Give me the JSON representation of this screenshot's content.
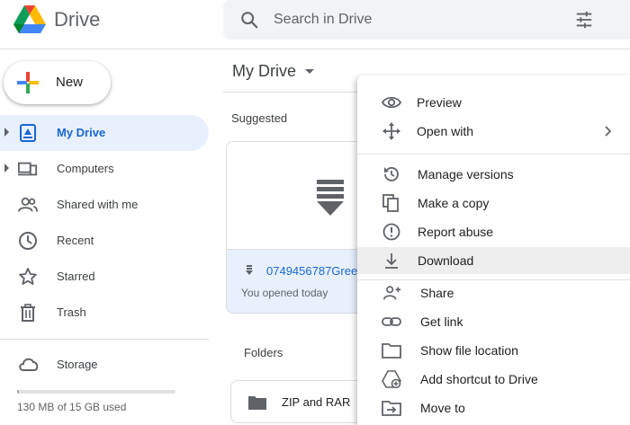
{
  "app": {
    "name": "Drive"
  },
  "search": {
    "placeholder": "Search in Drive"
  },
  "sidebar": {
    "new_label": "New",
    "items": [
      {
        "label": "My Drive",
        "active": true,
        "expandable": true,
        "icon": "my-drive-icon"
      },
      {
        "label": "Computers",
        "active": false,
        "expandable": true,
        "icon": "computers-icon"
      },
      {
        "label": "Shared with me",
        "active": false,
        "expandable": false,
        "icon": "people-icon"
      },
      {
        "label": "Recent",
        "active": false,
        "expandable": false,
        "icon": "clock-icon"
      },
      {
        "label": "Starred",
        "active": false,
        "expandable": false,
        "icon": "star-icon"
      },
      {
        "label": "Trash",
        "active": false,
        "expandable": false,
        "icon": "trash-icon"
      }
    ],
    "storage": {
      "label": "Storage",
      "usage_text": "130 MB of 15 GB used",
      "used_fraction": 0.0087
    }
  },
  "main": {
    "title": "My Drive",
    "suggested_label": "Suggested",
    "suggested_file": {
      "name": "0749456787Gree",
      "subtitle": "You opened today",
      "icon": "zip-file-icon"
    },
    "folders_label": "Folders",
    "folders": [
      {
        "name": "ZIP and RAR",
        "icon": "folder-icon"
      }
    ]
  },
  "context_menu": {
    "items": [
      {
        "label": "Preview",
        "icon": "eye-icon"
      },
      {
        "label": "Open with",
        "icon": "move-arrows-icon",
        "submenu": true
      },
      {
        "label": "Manage versions",
        "icon": "history-icon"
      },
      {
        "label": "Make a copy",
        "icon": "copy-icon"
      },
      {
        "label": "Report abuse",
        "icon": "alert-icon"
      },
      {
        "label": "Download",
        "icon": "download-icon",
        "highlighted": true
      },
      {
        "label": "Share",
        "icon": "add-person-icon"
      },
      {
        "label": "Get link",
        "icon": "link-icon"
      },
      {
        "label": "Show file location",
        "icon": "folder-outline-icon"
      },
      {
        "label": "Add shortcut to Drive",
        "icon": "shortcut-icon"
      },
      {
        "label": "Move to",
        "icon": "move-to-icon"
      }
    ]
  },
  "colors": {
    "accent_blue": "#1967d2",
    "active_nav_bg": "#e8f0fe",
    "search_bg": "#f1f3f4",
    "menu_highlight": "#eeeeee",
    "icon_gray": "#5f6368"
  }
}
